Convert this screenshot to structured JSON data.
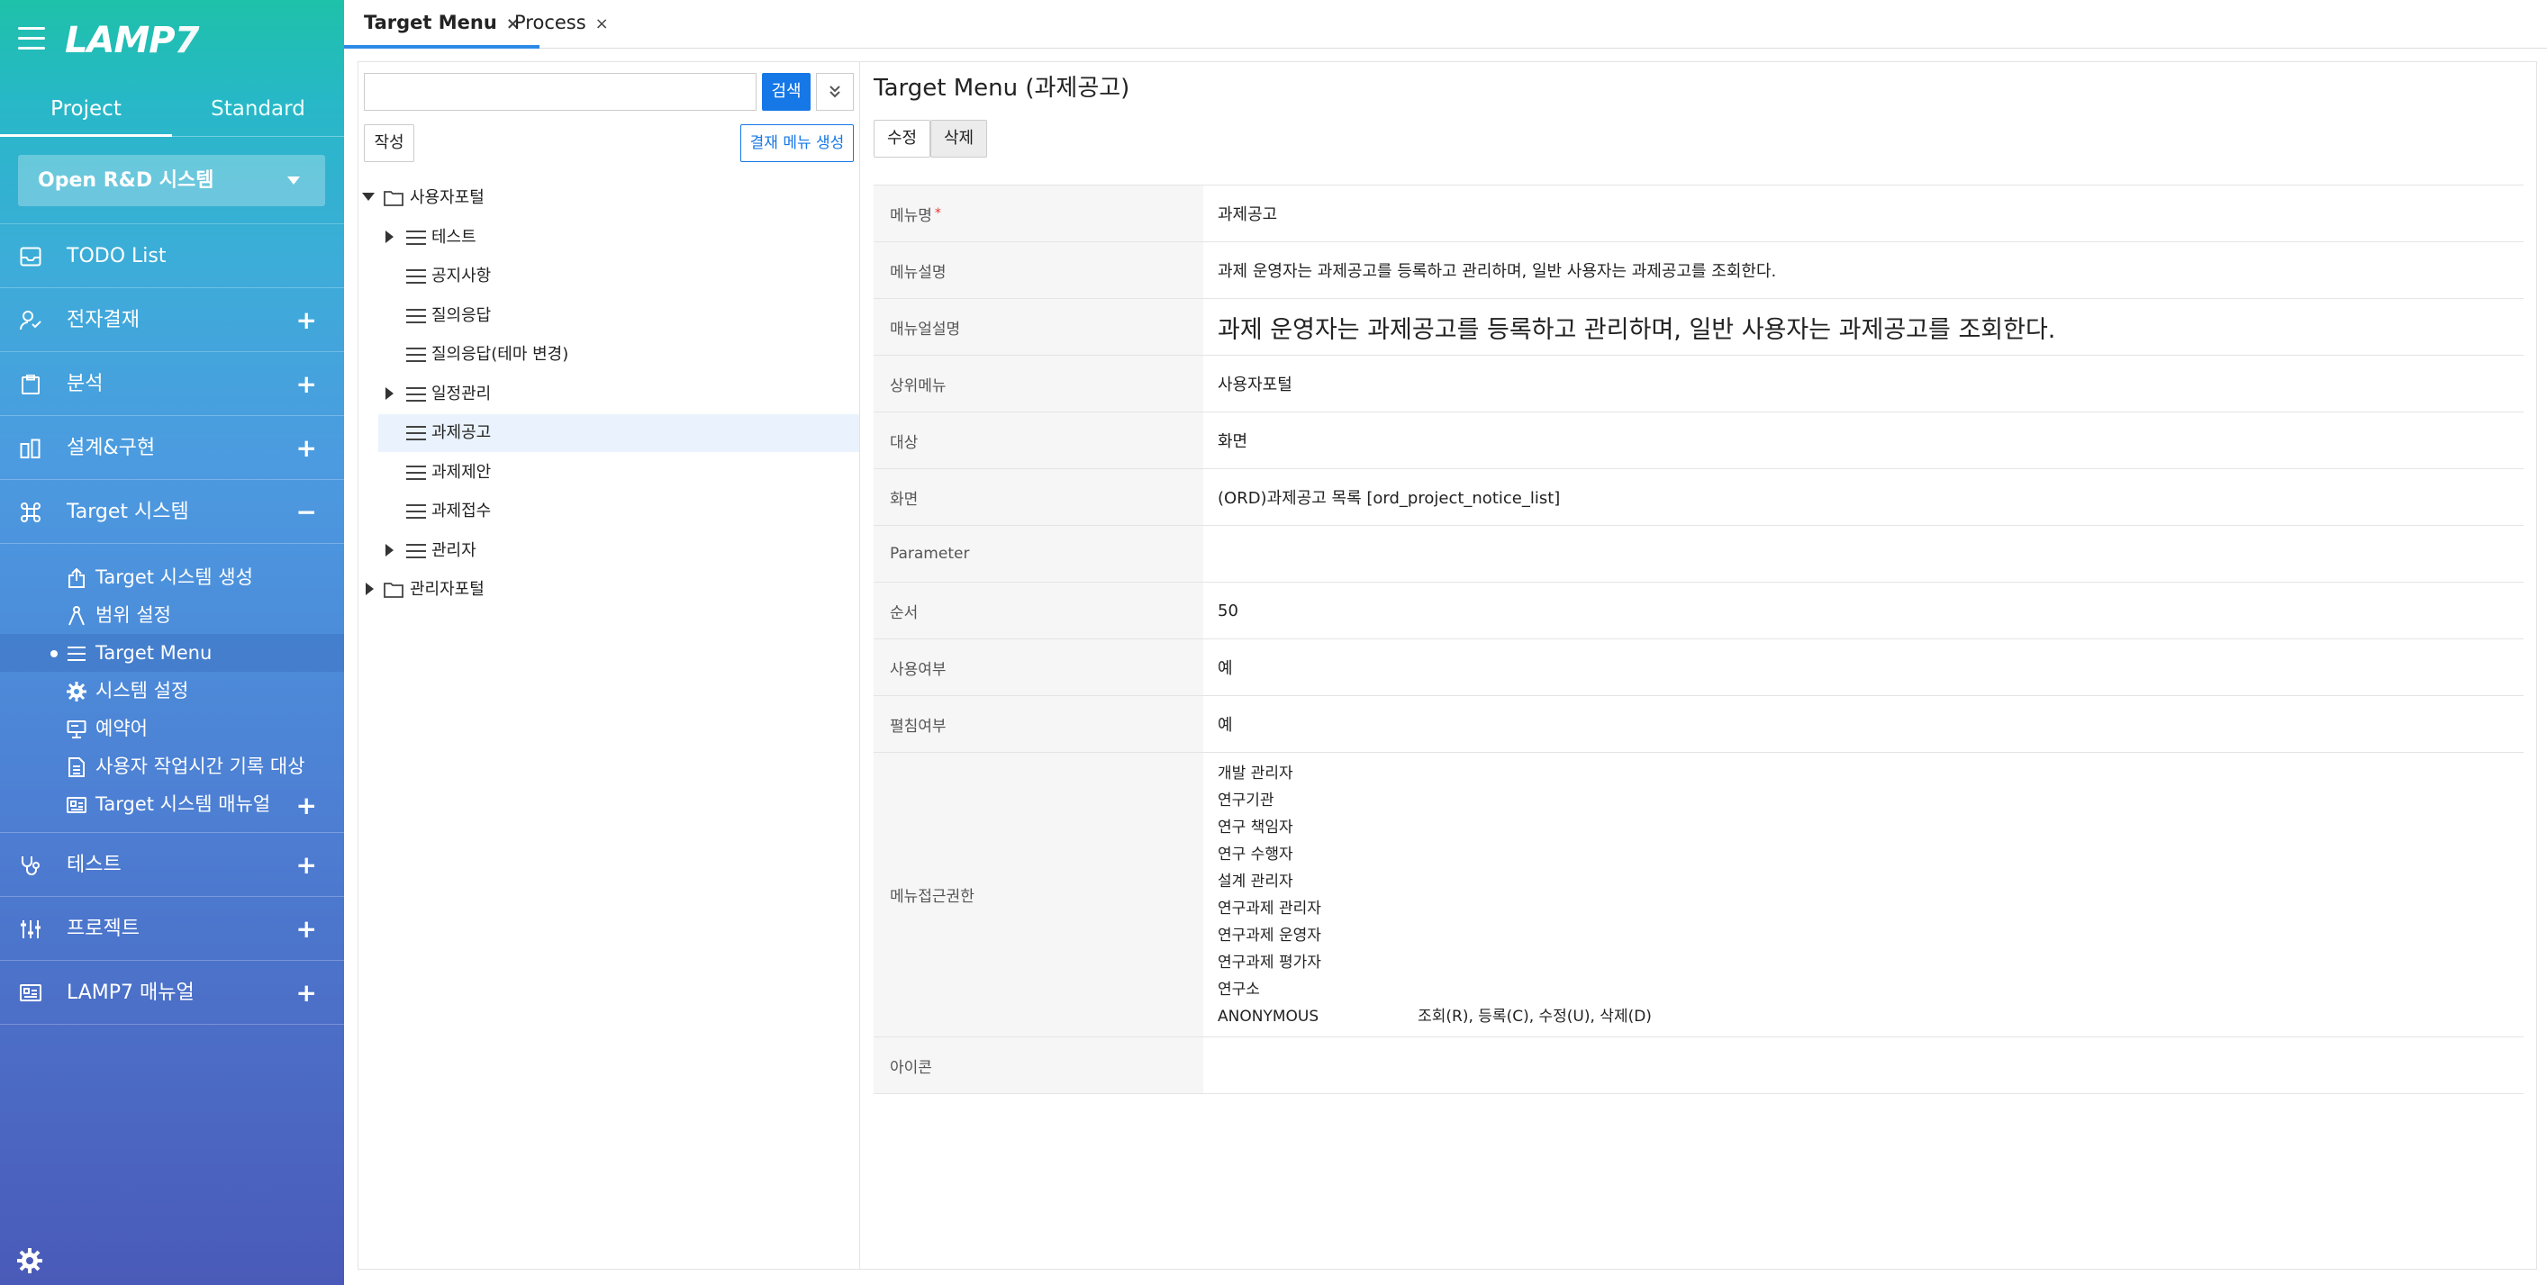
{
  "app": {
    "logo_text": "LAMP",
    "logo_num": "7"
  },
  "sidebar": {
    "tabs": [
      {
        "label": "Project",
        "active": true
      },
      {
        "label": "Standard",
        "active": false
      }
    ],
    "project_select": "Open R&D 시스템",
    "items": [
      {
        "label": "TODO List",
        "icon": "inbox-icon",
        "toggle": ""
      },
      {
        "label": "전자결재",
        "icon": "user-approval-icon",
        "toggle": "+"
      },
      {
        "label": "분석",
        "icon": "clipboard-icon",
        "toggle": "+"
      },
      {
        "label": "설계&구현",
        "icon": "design-icon",
        "toggle": "+"
      },
      {
        "label": "Target 시스템",
        "icon": "command-icon",
        "toggle": "−"
      }
    ],
    "sub_items": [
      {
        "label": "Target 시스템 생성",
        "icon": "export-icon"
      },
      {
        "label": "범위 설정",
        "icon": "compass-icon"
      },
      {
        "label": "Target Menu",
        "icon": "list-icon",
        "active": true
      },
      {
        "label": "시스템 설정",
        "icon": "gear-icon"
      },
      {
        "label": "예약어",
        "icon": "monitor-icon"
      },
      {
        "label": "사용자 작업시간 기록 대상",
        "icon": "document-icon"
      },
      {
        "label": "Target 시스템 매뉴얼",
        "icon": "manual-icon",
        "toggle": "+"
      }
    ],
    "items_after": [
      {
        "label": "테스트",
        "icon": "stethoscope-icon",
        "toggle": "+"
      },
      {
        "label": "프로젝트",
        "icon": "sliders-icon",
        "toggle": "+"
      },
      {
        "label": "LAMP7 매뉴얼",
        "icon": "manual-icon",
        "toggle": "+"
      }
    ]
  },
  "tabs": [
    {
      "label": "Target Menu",
      "close": "×",
      "active": true
    },
    {
      "label": "Process",
      "close": "×",
      "active": false
    }
  ],
  "tree_panel": {
    "search_value": "",
    "search_label": "검색",
    "write_label": "작성",
    "gen_label": "결재 메뉴 생성",
    "nodes": [
      {
        "label": "사용자포털",
        "type": "folder",
        "arrow": "down"
      },
      {
        "label": "테스트",
        "type": "menu",
        "arrow": "right"
      },
      {
        "label": "공지사항",
        "type": "menu",
        "arrow": ""
      },
      {
        "label": "질의응답",
        "type": "menu",
        "arrow": ""
      },
      {
        "label": "질의응답(테마 변경)",
        "type": "menu",
        "arrow": ""
      },
      {
        "label": "일정관리",
        "type": "menu",
        "arrow": "right"
      },
      {
        "label": "과제공고",
        "type": "menu",
        "arrow": "",
        "selected": true
      },
      {
        "label": "과제제안",
        "type": "menu",
        "arrow": ""
      },
      {
        "label": "과제접수",
        "type": "menu",
        "arrow": ""
      },
      {
        "label": "관리자",
        "type": "menu",
        "arrow": "right"
      },
      {
        "label": "관리자포털",
        "type": "folder",
        "arrow": "right"
      }
    ]
  },
  "detail": {
    "title": "Target Menu (과제공고)",
    "edit_label": "수정",
    "delete_label": "삭제",
    "required_mark": "*",
    "rows": [
      {
        "key": "메뉴명",
        "value": "과제공고",
        "required": true
      },
      {
        "key": "메뉴설명",
        "value": "과제 운영자는 과제공고를 등록하고 관리하며, 일반 사용자는 과제공고를 조회한다."
      },
      {
        "key": "매뉴얼설명",
        "value": "과제 운영자는 과제공고를 등록하고 관리하며, 일반 사용자는 과제공고를 조회한다.",
        "big": true
      },
      {
        "key": "상위메뉴",
        "value": "사용자포털"
      },
      {
        "key": "대상",
        "value": "화면"
      },
      {
        "key": "화면",
        "value": "(ORD)과제공고 목록 [ord_project_notice_list]"
      },
      {
        "key": "Parameter",
        "value": ""
      },
      {
        "key": "순서",
        "value": "50"
      },
      {
        "key": "사용여부",
        "value": "예"
      },
      {
        "key": "펼침여부",
        "value": "예"
      }
    ],
    "auth": {
      "key": "메뉴접근권한",
      "roles": [
        "개발 관리자",
        "연구기관",
        "연구 책임자",
        "연구 수행자",
        "설계 관리자",
        "연구과제 관리자",
        "연구과제 운영자",
        "연구과제 평가자",
        "연구소",
        "ANONYMOUS"
      ],
      "anonymous_perm": "조회(R), 등록(C), 수정(U), 삭제(D)"
    },
    "icon_row": {
      "key": "아이콘",
      "value": ""
    }
  },
  "colors": {
    "accent": "#1677e6",
    "sidebar_top": "#1ec1a9",
    "sidebar_bottom": "#4a5ab8",
    "selection": "#eaf3fd"
  }
}
